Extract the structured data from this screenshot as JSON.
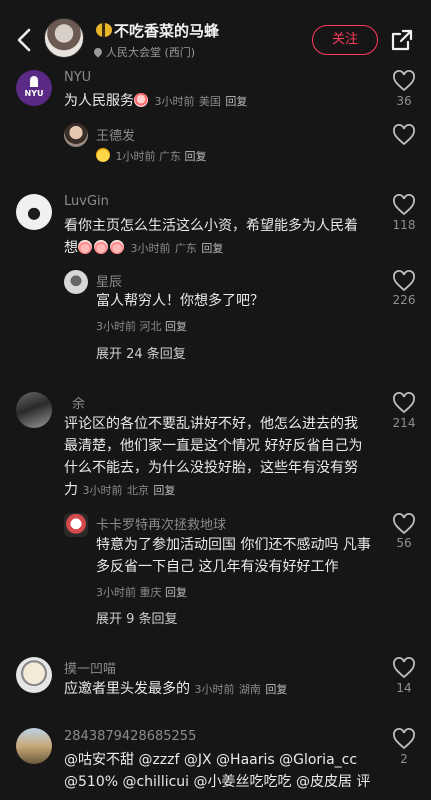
{
  "header": {
    "title": "不吃香菜的马蜂",
    "location": "人民大会堂 (西门)",
    "follow_label": "关注"
  },
  "comments": [
    {
      "user": "NYU",
      "text": "为人民服务",
      "time": "3小时前",
      "region": "美国",
      "reply_label": "回复",
      "likes": "36",
      "avatar_text": "NYU"
    },
    {
      "user": "王德发",
      "time": "1小时前",
      "region": "广东",
      "reply_label": "回复"
    },
    {
      "user": "LuvGin",
      "text_line1": "看你主页怎么生活这么小资，希望能多为人民着",
      "text_line2": "想",
      "time": "3小时前",
      "region": "广东",
      "reply_label": "回复",
      "likes": "118"
    },
    {
      "user": "星辰",
      "text": "富人帮穷人！你想多了吧？",
      "time": "3小时前",
      "region": "河北",
      "reply_label": "回复",
      "likes": "226",
      "expand_label": "展开 24 条回复"
    },
    {
      "user": "余",
      "lines": [
        "评论区的各位不要乱讲好不好，他怎么进去的我",
        "最清楚，他们家一直是这个情况 好好反省自己为",
        "什么不能去，为什么没投好胎，这些年有没有努",
        "力"
      ],
      "time": "3小时前",
      "region": "北京",
      "reply_label": "回复",
      "likes": "214"
    },
    {
      "user": "卡卡罗特再次拯救地球",
      "lines": [
        "特意为了参加活动回国 你们还不感动吗 凡事",
        "多反省一下自己 这几年有没有好好工作"
      ],
      "time": "3小时前",
      "region": "重庆",
      "reply_label": "回复",
      "likes": "56",
      "expand_label": "展开 9 条回复"
    },
    {
      "user": "摸一凹喵",
      "text": "应邀者里头发最多的",
      "time": "3小时前",
      "region": "湖南",
      "reply_label": "回复",
      "likes": "14"
    },
    {
      "user": "2843879428685255",
      "lines": [
        "@咕安不甜 @zzzf @JX @Haaris @Gloria_cc",
        "@510% @chillicui @小姜丝吃吃吃 @皮皮居 评"
      ],
      "likes": "2"
    }
  ],
  "icons": {
    "back": "back-arrow-icon",
    "share": "share-icon",
    "like": "heart-outline-icon",
    "location": "location-pin-icon"
  },
  "colors": {
    "background": "#161616",
    "accent": "#ff3b5c"
  }
}
